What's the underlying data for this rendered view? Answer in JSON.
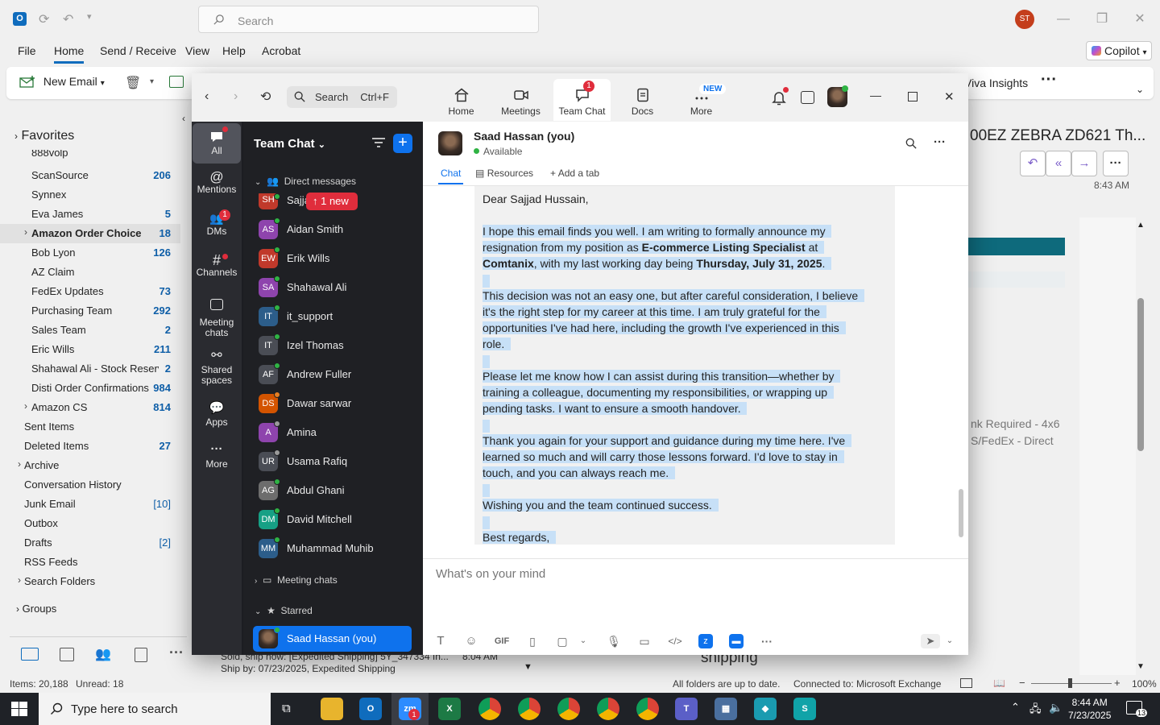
{
  "outlook": {
    "search_placeholder": "Search",
    "avatar_initials": "ST",
    "menu": [
      "File",
      "Home",
      "Send / Receive",
      "View",
      "Help",
      "Acrobat"
    ],
    "copilot_label": "Copilot",
    "new_email_label": "New Email",
    "viva_label": "Viva Insights",
    "favorites_label": "Favorites",
    "folders": [
      {
        "name": "888volp",
        "count": ""
      },
      {
        "name": "ScanSource",
        "count": "206"
      },
      {
        "name": "Synnex",
        "count": ""
      },
      {
        "name": "Eva James",
        "count": "5"
      },
      {
        "name": "Amazon Order Choice",
        "count": "18"
      },
      {
        "name": "Bob Lyon",
        "count": "126"
      },
      {
        "name": "AZ Claim",
        "count": ""
      },
      {
        "name": "FedEx Updates",
        "count": "73"
      },
      {
        "name": "Purchasing Team",
        "count": "292"
      },
      {
        "name": "Sales Team",
        "count": "2"
      },
      {
        "name": "Eric Wills",
        "count": "211"
      },
      {
        "name": "Shahawal Ali - Stock Reserv...",
        "count": "2"
      },
      {
        "name": "Disti Order Confirmations",
        "count": "984"
      },
      {
        "name": "Amazon CS",
        "count": "814"
      }
    ],
    "top_folders": [
      {
        "name": "Sent Items",
        "count": ""
      },
      {
        "name": "Deleted Items",
        "count": "27"
      },
      {
        "name": "Archive",
        "count": ""
      },
      {
        "name": "Conversation History",
        "count": ""
      },
      {
        "name": "Junk Email",
        "count": "[10]"
      },
      {
        "name": "Outbox",
        "count": ""
      },
      {
        "name": "Drafts",
        "count": "[2]"
      },
      {
        "name": "RSS Feeds",
        "count": ""
      },
      {
        "name": "Search Folders",
        "count": ""
      }
    ],
    "groups_label": "Groups",
    "reading_subject": "00EZ ZEBRA ZD621 Th...",
    "reading_time": "8:43 AM",
    "reading_snippet_1": "nk Required - 4x6",
    "reading_snippet_2": "S/FedEx - Direct",
    "peek_line_1": "Sold, ship now: [Expedited Shipping] 5Y_347334 In...",
    "peek_line_2": "Ship by: 07/23/2025, Expedited Shipping",
    "peek_time": "8:04 AM",
    "peek_brand": "shipping",
    "status_items": "Items: 20,188",
    "status_unread": "Unread: 18",
    "status_sync": "All folders are up to date.",
    "status_conn": "Connected to: Microsoft Exchange",
    "status_zoom": "100%"
  },
  "taskbar": {
    "search_placeholder": "Type here to search",
    "time": "8:44 AM",
    "date": "7/23/2025",
    "notif_count": "13"
  },
  "zoom": {
    "search_label": "Search",
    "search_shortcut": "Ctrl+F",
    "nav": [
      {
        "label": "Home",
        "icon": "home-icon"
      },
      {
        "label": "Meetings",
        "icon": "video-icon"
      },
      {
        "label": "Team Chat",
        "icon": "chat-icon",
        "badge": "1"
      },
      {
        "label": "Docs",
        "icon": "docs-icon"
      },
      {
        "label": "More",
        "icon": "more-icon",
        "badge": "NEW"
      }
    ],
    "rail": [
      {
        "label": "All"
      },
      {
        "label": "Mentions"
      },
      {
        "label": "DMs",
        "badge": "1"
      },
      {
        "label": "Channels"
      },
      {
        "label": "Meeting chats"
      },
      {
        "label": "Shared spaces"
      },
      {
        "label": "Apps"
      },
      {
        "label": "More"
      }
    ],
    "team_chat_title": "Team Chat",
    "direct_messages_label": "Direct messages",
    "new_pill": "↑ 1 new",
    "contacts": [
      {
        "initials": "SH",
        "name": "Sajjad Hussain",
        "color": "#c0392b",
        "presence": "#2fb344"
      },
      {
        "initials": "AS",
        "name": "Aidan Smith",
        "color": "#8e44ad",
        "presence": "#2fb344"
      },
      {
        "initials": "EW",
        "name": "Erik Wills",
        "color": "#c0392b",
        "presence": "#2fb344"
      },
      {
        "initials": "SA",
        "name": "Shahawal Ali",
        "color": "#8e44ad",
        "presence": "#2fb344"
      },
      {
        "initials": "IT",
        "name": "it_support",
        "color": "#2c5d8a",
        "presence": "#2fb344"
      },
      {
        "initials": "IT",
        "name": "Izel Thomas",
        "color": "#4a4d55",
        "presence": "#2fb344"
      },
      {
        "initials": "AF",
        "name": "Andrew Fuller",
        "color": "#4a4d55",
        "presence": "#2fb344"
      },
      {
        "initials": "DS",
        "name": "Dawar sarwar",
        "color": "#d35400",
        "presence": "#e67e22"
      },
      {
        "initials": "A",
        "name": "Amina",
        "color": "#8e44ad",
        "presence": "#9a9a9a"
      },
      {
        "initials": "UR",
        "name": "Usama Rafiq",
        "color": "#4a4d55",
        "presence": "#9a9a9a"
      },
      {
        "initials": "AG",
        "name": "Abdul Ghani",
        "color": "#6d6d6d",
        "presence": "#2fb344"
      },
      {
        "initials": "DM",
        "name": "David Mitchell",
        "color": "#16a085",
        "presence": "#2fb344"
      },
      {
        "initials": "MM",
        "name": "Muhammad Muhib",
        "color": "#2c5d8a",
        "presence": "#2fb344"
      }
    ],
    "meeting_chats_label": "Meeting chats",
    "starred_label": "Starred",
    "starred_contact": "Saad Hassan (you)",
    "chat_header_name": "Saad Hassan (you)",
    "chat_header_status": "Available",
    "tabs": [
      "Chat",
      "Resources",
      "Add a tab"
    ],
    "message_lines": [
      {
        "t": "Dear Sajjad Hussain,",
        "sel": false
      },
      {
        "t": "I hope this email finds you well. I am writing to formally announce my",
        "sel": true
      },
      {
        "t": "resignation from my position as ",
        "b": "E-commerce Listing Specialist",
        "t2": " at",
        "sel": true
      },
      {
        "b": "Comtanix",
        "t2": ", with my last working day being ",
        "b2": "Thursday, July 31, 2025",
        "t3": ".",
        "sel": true
      },
      {
        "t": "This decision was not an easy one, but after careful consideration, I believe",
        "sel": true
      },
      {
        "t": "it's the right step for my career at this time. I am truly grateful for the",
        "sel": true
      },
      {
        "t": "opportunities I've had here, including the growth I've experienced in this",
        "sel": true
      },
      {
        "t": "role.",
        "sel": true
      },
      {
        "t": "Please let me know how I can assist during this transition—whether by",
        "sel": true
      },
      {
        "t": "training a colleague, documenting my responsibilities, or wrapping up",
        "sel": true
      },
      {
        "t": "pending tasks. I want to ensure a smooth handover.",
        "sel": true
      },
      {
        "t": "Thank you again for your support and guidance during my time here. I've",
        "sel": true
      },
      {
        "t": "learned so much and will carry those lessons forward. I'd love to stay in",
        "sel": true
      },
      {
        "t": "touch, and you can always reach me.",
        "sel": true
      },
      {
        "t": "Wishing you and the team continued success.",
        "sel": true
      },
      {
        "t": "Best regards,",
        "sel": true
      }
    ],
    "composer_placeholder": "What's on your mind",
    "composer_gif": "GIF"
  }
}
